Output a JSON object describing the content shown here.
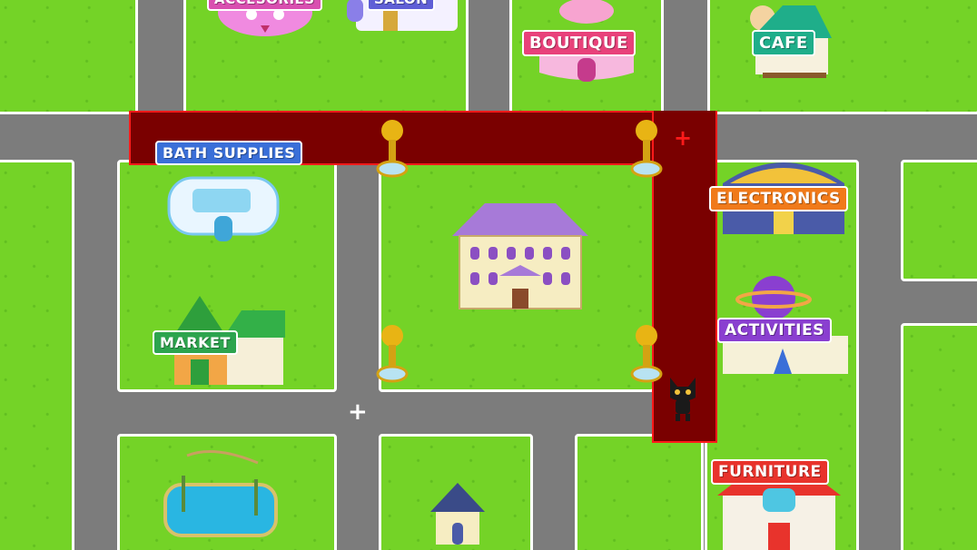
{
  "labels": {
    "accessories": "ACCESORIES",
    "salon": "SALON",
    "boutique": "BOUTIQUE",
    "cafe": "CAFE",
    "bath_supplies": "BATH SUPPLIES",
    "electronics": "ELECTRONICS",
    "market": "MARKET",
    "activities": "ACTIVITIES",
    "furniture": "FURNITURE"
  },
  "markers": {
    "plus": "+"
  },
  "colors": {
    "grass": "#74d327",
    "road": "#7c7c7c",
    "route_fill": "#7a0000",
    "route_border": "#ff1a1a",
    "boutique_sign": "#e8417a",
    "cafe_sign": "#1fae8a",
    "bath_sign": "#3a6fd8",
    "electronics_sign": "#f07a1a",
    "market_sign": "#2da44e",
    "activities_sign": "#8a3fd0",
    "furniture_sign": "#e8332c"
  }
}
